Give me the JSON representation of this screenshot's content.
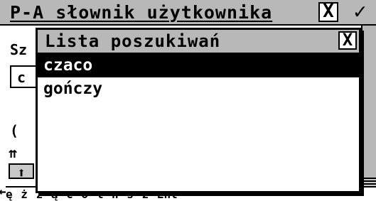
{
  "main_window": {
    "title": "P-A słownik użytkownika",
    "close_label": "X",
    "ok_label": "✓",
    "label_fragment": "Sz",
    "field_fragment": "c",
    "paren_fragment": "(",
    "arrow_up_double": "⇈",
    "arrow_up": "⬆",
    "arrow_left": "⟵"
  },
  "keyboard_row": [
    "ę",
    "ż",
    "ź",
    "ą",
    "ć",
    "ó",
    "ł",
    "ń",
    "ś",
    "ż",
    "Ent"
  ],
  "dialog": {
    "title": "Lista poszukiwań",
    "close_label": "X",
    "items": [
      "czaco",
      "gończy"
    ],
    "selected_index": 0
  }
}
